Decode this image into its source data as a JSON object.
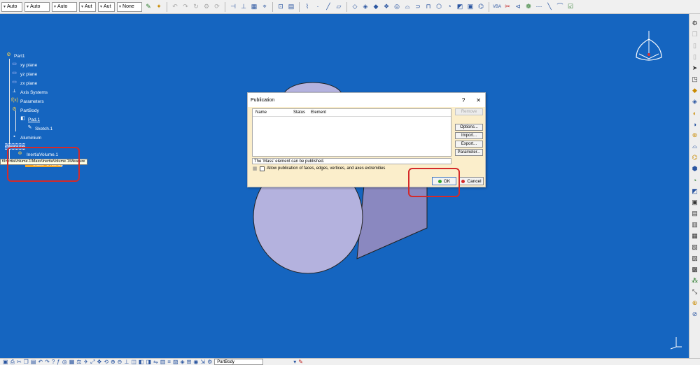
{
  "top_toolbar": {
    "combos": [
      "Auto",
      "Auto",
      "Auto",
      "Aut",
      "Aut",
      "None"
    ]
  },
  "tree": {
    "root": "Part1",
    "items": {
      "xy_plane": "xy plane",
      "yz_plane": "yz plane",
      "zx_plane": "zx plane",
      "axis_systems": "Axis Systems",
      "parameters": "Parameters",
      "partbody": "PartBody",
      "pad": "Pad.1",
      "sketch": "Sketch.1",
      "material": "Aluminium",
      "measure": "Measure",
      "inertia": "InertiaVolume.1",
      "mass": "Mass=8482.1g"
    },
    "tooltip": "t\\InertiaVolume.1\\Mass\\InertiaVolume.1\\Measure"
  },
  "dialog": {
    "title": "Publication",
    "help": "?",
    "close": "✕",
    "columns": [
      "Name",
      "Status",
      "Element"
    ],
    "side_buttons": {
      "remove": "Remove",
      "options": "Options...",
      "import": "Import...",
      "export": "Export...",
      "parameter": "Parameter..."
    },
    "status": "The 'Mass' element can be published.",
    "allow_label": "Allow publication of faces, edges, vertices, and axes extremities",
    "ok": "OK",
    "cancel": "Cancel"
  },
  "bottom_toolbar": {
    "partbody_combo": "PartBody"
  },
  "colors": {
    "viewport_bg": "#1565c0",
    "dialog_bg": "#fbeecb",
    "highlight": "#d42a2a",
    "selection": "#f5a623"
  }
}
